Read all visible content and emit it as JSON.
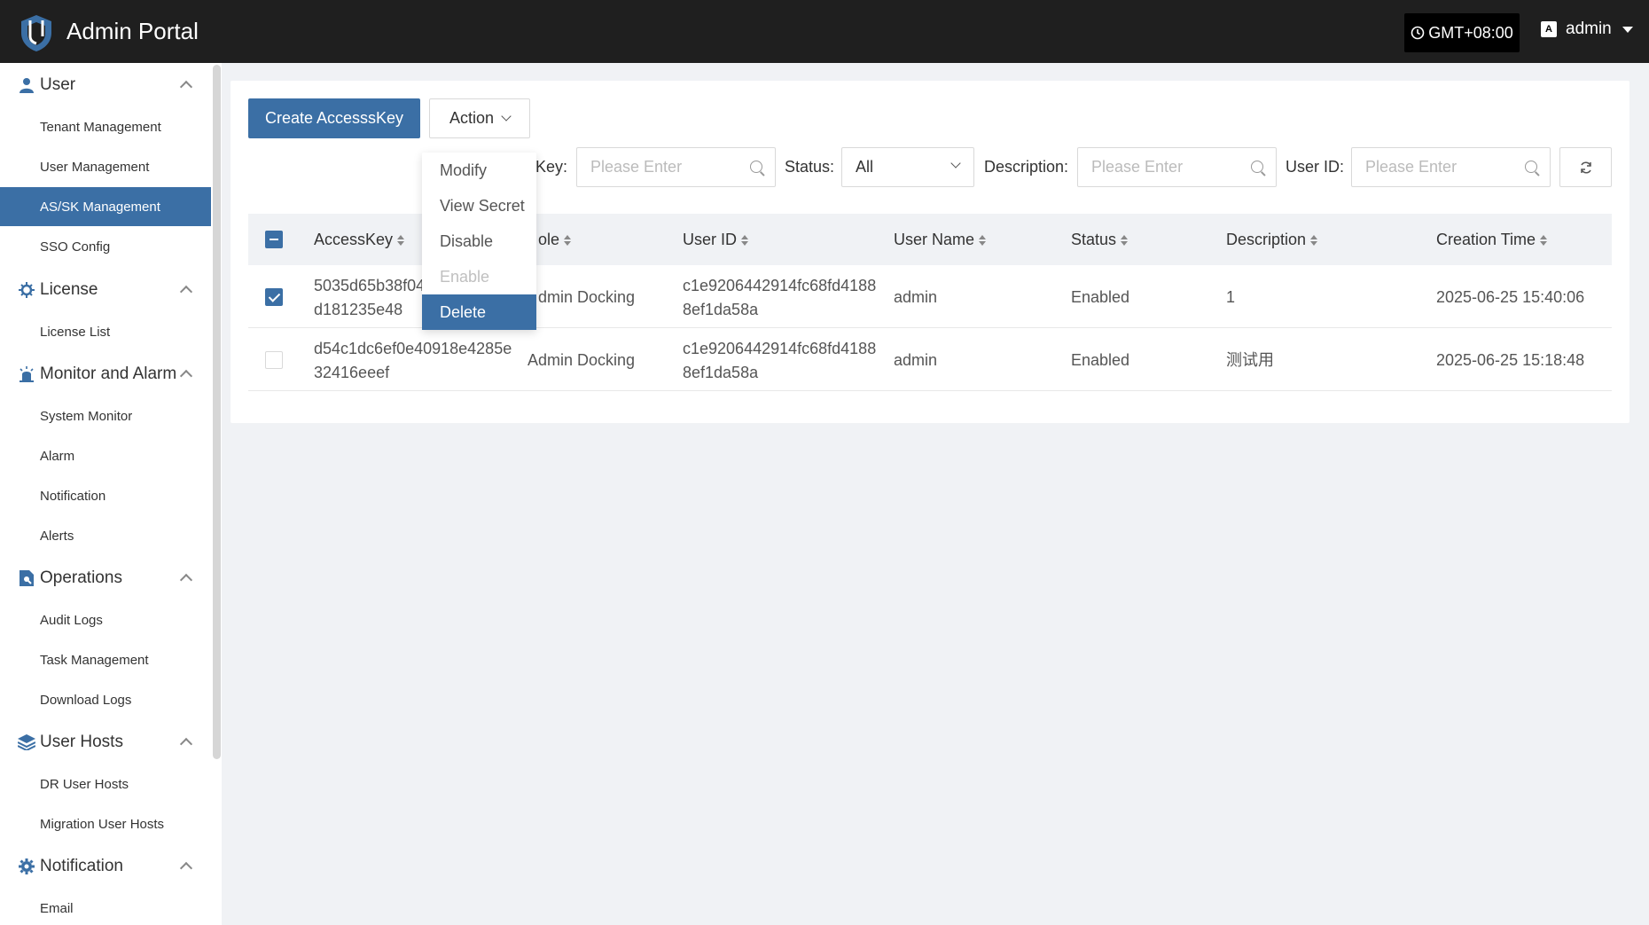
{
  "header": {
    "title": "Admin Portal",
    "timezone": "GMT+08:00",
    "user": "admin",
    "lang_icon": "A"
  },
  "sidebar": {
    "groups": [
      {
        "label": "User",
        "icon": "user-icon",
        "items": [
          "Tenant Management",
          "User Management",
          "AS/SK Management",
          "SSO Config"
        ]
      },
      {
        "label": "License",
        "icon": "license-icon",
        "items": [
          "License List"
        ]
      },
      {
        "label": "Monitor and Alarm",
        "icon": "alarm-icon",
        "items": [
          "System Monitor",
          "Alarm",
          "Notification",
          "Alerts"
        ]
      },
      {
        "label": "Operations",
        "icon": "operations-icon",
        "items": [
          "Audit Logs",
          "Task Management",
          "Download Logs"
        ]
      },
      {
        "label": "User Hosts",
        "icon": "layers-icon",
        "items": [
          "DR User Hosts",
          "Migration User Hosts"
        ]
      },
      {
        "label": "Notification",
        "icon": "gear-icon",
        "items": [
          "Email"
        ]
      }
    ],
    "active_item": "AS/SK Management"
  },
  "toolbar": {
    "create_label": "Create AccesssKey",
    "action_label": "Action"
  },
  "filters": {
    "key_label": "Key:",
    "key_placeholder": "Please Enter",
    "status_label": "Status:",
    "status_value": "All",
    "description_label": "Description:",
    "description_placeholder": "Please Enter",
    "userid_label": "User ID:",
    "userid_placeholder": "Please Enter"
  },
  "action_menu": {
    "items": [
      "Modify",
      "View Secret",
      "Disable",
      "Enable",
      "Delete"
    ],
    "disabled": [
      "Enable"
    ],
    "highlighted": "Delete"
  },
  "table": {
    "headers": [
      "AccessKey",
      "ole",
      "User ID",
      "User Name",
      "Status",
      "Description",
      "Creation Time"
    ],
    "rows": [
      {
        "checked": true,
        "accesskey": [
          "5035d65b38f04",
          "d181235e48"
        ],
        "role": "dmin Docking",
        "user_id": [
          "c1e9206442914fc68fd4188",
          "8ef1da58a"
        ],
        "user_name": "admin",
        "status": "Enabled",
        "description": "1",
        "created": "2025-06-25 15:40:06"
      },
      {
        "checked": false,
        "accesskey": [
          "d54c1dc6ef0e40918e4285e",
          "32416eeef"
        ],
        "role": "Admin Docking",
        "user_id": [
          "c1e9206442914fc68fd4188",
          "8ef1da58a"
        ],
        "user_name": "admin",
        "status": "Enabled",
        "description": "测试用",
        "created": "2025-06-25 15:18:48"
      }
    ]
  },
  "colors": {
    "header_bg": "#1f1f1f",
    "primary": "#3b6fa5",
    "page_bg": "#f0f2f5"
  }
}
